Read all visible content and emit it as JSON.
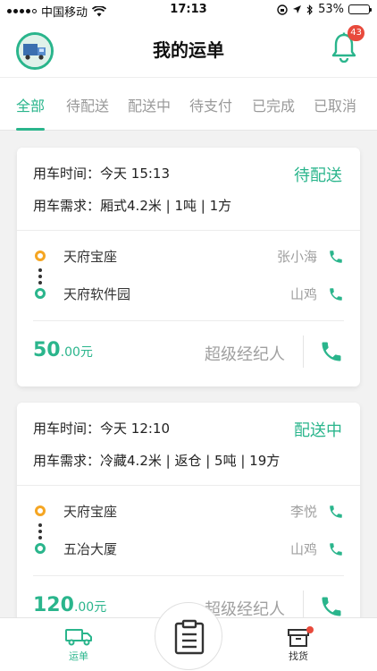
{
  "status_bar": {
    "carrier": "中国移动",
    "time": "17:13",
    "battery": "53%",
    "battery_level": 0.53
  },
  "header": {
    "title": "我的运单",
    "notification_count": "43"
  },
  "tabs": [
    {
      "label": "全部",
      "active": true
    },
    {
      "label": "待配送",
      "active": false
    },
    {
      "label": "配送中",
      "active": false
    },
    {
      "label": "待支付",
      "active": false
    },
    {
      "label": "已完成",
      "active": false
    },
    {
      "label": "已取消",
      "active": false
    }
  ],
  "orders": [
    {
      "time_label": "用车时间：",
      "time_value": "今天 15:13",
      "status": "待配送",
      "req_label": "用车需求：",
      "req_value": "厢式4.2米 | 1吨 | 1方",
      "from_place": "天府宝座",
      "from_contact": "张小海",
      "to_place": "天府软件园",
      "to_contact": "山鸡",
      "price_int": "50",
      "price_dec": ".00元",
      "agent": "超级经纪人"
    },
    {
      "time_label": "用车时间：",
      "time_value": "今天 12:10",
      "status": "配送中",
      "req_label": "用车需求：",
      "req_value": "冷藏4.2米 | 返仓 | 5吨 | 19方",
      "from_place": "天府宝座",
      "from_contact": "李悦",
      "to_place": "五冶大厦",
      "to_contact": "山鸡",
      "price_int": "120",
      "price_dec": ".00元",
      "agent": "超级经纪人"
    }
  ],
  "bottom_nav": {
    "left_label": "运单",
    "right_label": "找货"
  },
  "colors": {
    "accent": "#2ab58c",
    "origin": "#f5a623",
    "badge": "#e84a3c"
  }
}
